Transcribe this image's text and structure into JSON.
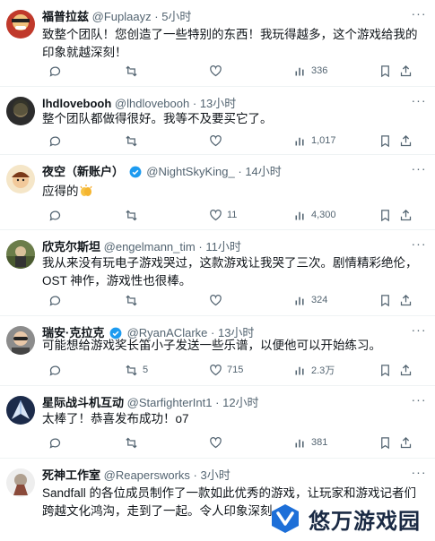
{
  "posts": [
    {
      "name": "福普拉兹",
      "handle": "@Fuplaayz",
      "time": "5小时",
      "verified": false,
      "text": "致整个团队！您创造了一些特别的东西！我玩得越多，这个游戏给我的印象就越深刻！",
      "replies": "",
      "retweets": "",
      "likes": "",
      "views": "336"
    },
    {
      "name": "lhdlovebooh",
      "handle": "@lhdlovebooh",
      "time": "13小时",
      "verified": false,
      "text": "整个团队都做得很好。我等不及要买它了。",
      "replies": "",
      "retweets": "",
      "likes": "",
      "views": "1,017"
    },
    {
      "name": "夜空（新账户）",
      "handle": "@NightSkyKing_",
      "time": "14小时",
      "verified": true,
      "text": "应得的",
      "emoji": "clapping-hands",
      "replies": "",
      "retweets": "",
      "likes": "11",
      "views": "4,300"
    },
    {
      "name": "欣克尔斯坦",
      "handle": "@engelmann_tim",
      "time": "11小时",
      "verified": false,
      "text": "我从来没有玩电子游戏哭过，这款游戏让我哭了三次。剧情精彩绝伦，OST 神作，游戏性也很棒。",
      "replies": "",
      "retweets": "",
      "likes": "",
      "views": "324"
    },
    {
      "name": "瑞安·克拉克",
      "handle": "@RyanAClarke",
      "time": "13小时",
      "verified": true,
      "text": "可能想给游戏奖长笛小子发送一些乐谱，以便他可以开始练习。",
      "replies": "",
      "retweets": "5",
      "likes": "715",
      "views": "2.3万"
    },
    {
      "name": "星际战斗机互动",
      "handle": "@StarfighterInt1",
      "time": "12小时",
      "verified": false,
      "text": "太棒了！恭喜发布成功！o7",
      "replies": "",
      "retweets": "",
      "likes": "",
      "views": "381"
    },
    {
      "name": "死神工作室",
      "handle": "@Reapersworks",
      "time": "3小时",
      "verified": false,
      "text": "Sandfall 的各位成员制作了一款如此优秀的游戏，让玩家和游戏记者们跨越文化鸿沟，走到了一起。令人印象深刻。",
      "replies": "",
      "retweets": "",
      "likes": "",
      "views": ""
    }
  ],
  "separator": "·",
  "watermark": {
    "text": "悠万游戏园"
  },
  "colors": {
    "verified": "#1d9bf0",
    "muted": "#536471",
    "text": "#0f1419"
  }
}
